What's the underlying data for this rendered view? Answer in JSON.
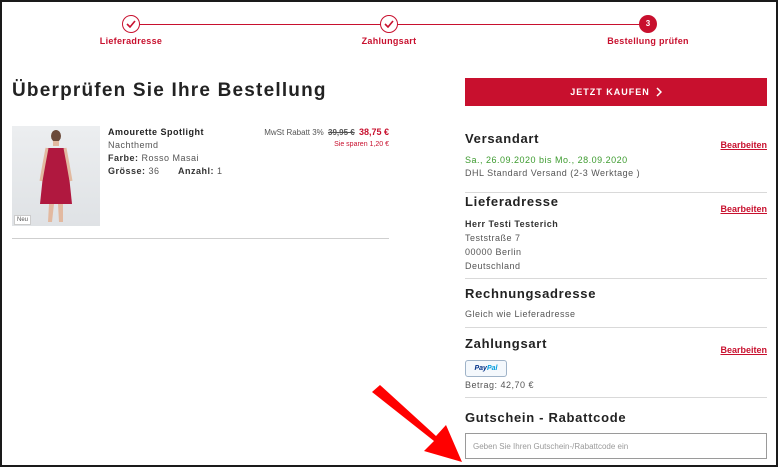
{
  "stepper": {
    "steps": [
      {
        "label": "Lieferadresse",
        "state": "done"
      },
      {
        "label": "Zahlungsart",
        "state": "done"
      },
      {
        "label": "Bestellung prüfen",
        "state": "active",
        "number": "3"
      }
    ]
  },
  "page_title": "Überprüfen Sie Ihre Bestellung",
  "product": {
    "badge": "Neu",
    "name": "Amourette Spotlight",
    "type": "Nachthemd",
    "color_label": "Farbe:",
    "color_value": "Rosso Masai",
    "size_label": "Grösse:",
    "size_value": "36",
    "qty_label": "Anzahl:",
    "qty_value": "1",
    "tax_label": "MwSt Rabatt 3%",
    "old_price": "39,95 €",
    "new_price": "38,75 €",
    "savings": "Sie sparen 1,20 €"
  },
  "buy_button": {
    "label": "JETZT KAUFEN"
  },
  "shipping": {
    "title": "Versandart",
    "edit": "Bearbeiten",
    "dates": "Sa., 26.09.2020 bis Mo., 28.09.2020",
    "method": "DHL Standard Versand (2-3 Werktage )"
  },
  "delivery_address": {
    "title": "Lieferadresse",
    "edit": "Bearbeiten",
    "name": "Herr Testi Testerich",
    "street": "Teststraße 7",
    "city": "00000 Berlin",
    "country": "Deutschland"
  },
  "billing_address": {
    "title": "Rechnungsadresse",
    "text": "Gleich wie Lieferadresse"
  },
  "payment": {
    "title": "Zahlungsart",
    "edit": "Bearbeiten",
    "logo_part1": "Pay",
    "logo_part2": "Pal",
    "amount": "Betrag: 42,70 €"
  },
  "coupon": {
    "title": "Gutschein - Rabattcode",
    "placeholder": "Geben Sie Ihren Gutschein-/Rabattcode ein"
  },
  "colors": {
    "accent": "#c8102e",
    "green": "#3d9b2f",
    "arrow": "#ff0000"
  }
}
